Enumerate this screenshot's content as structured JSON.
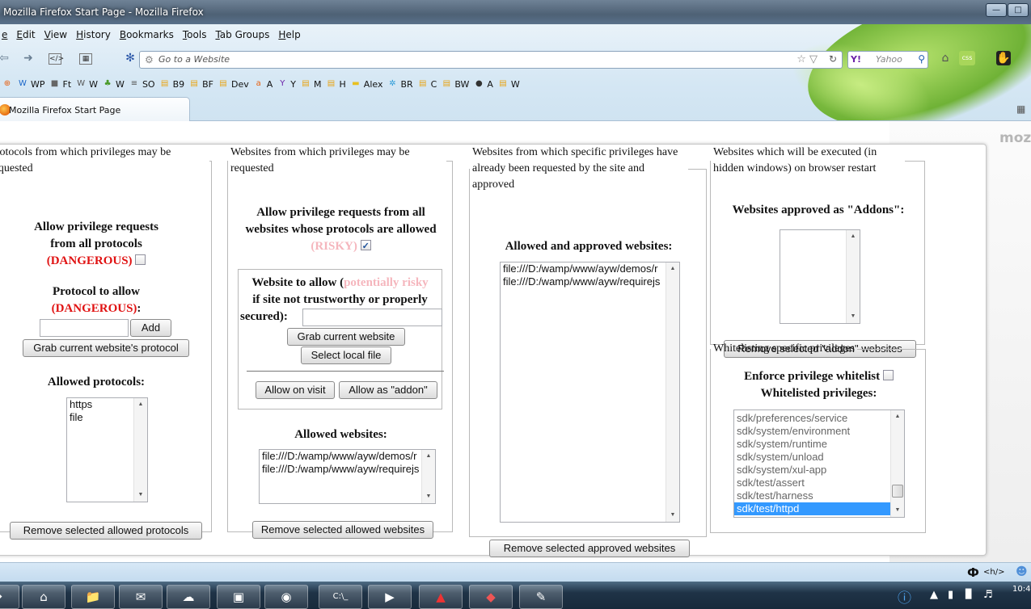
{
  "window": {
    "title": "Mozilla Firefox Start Page - Mozilla Firefox",
    "minimize": "—",
    "maximize": "□"
  },
  "menubar": [
    "e",
    "Edit",
    "View",
    "History",
    "Bookmarks",
    "Tools",
    "Tab Groups",
    "Help"
  ],
  "nav": {
    "url_placeholder": "Go to a Website",
    "search_placeholder": "Yahoo",
    "search_engine": "Y!"
  },
  "bookmarks": [
    {
      "label": "WP",
      "color": "#1b66c9",
      "icon": "W"
    },
    {
      "label": "Ft",
      "color": "#666",
      "icon": "■"
    },
    {
      "label": "W",
      "color": "#555",
      "icon": "W"
    },
    {
      "label": "W",
      "color": "#4a9a2a",
      "icon": "♣"
    },
    {
      "label": "SO",
      "color": "#555",
      "icon": "≡"
    },
    {
      "label": "B9",
      "color": "#e8a416",
      "icon": "▤"
    },
    {
      "label": "BF",
      "color": "#e8a416",
      "icon": "▤"
    },
    {
      "label": "Dev",
      "color": "#e8a416",
      "icon": "▤"
    },
    {
      "label": "A",
      "color": "#e85f0f",
      "icon": "a"
    },
    {
      "label": "Y",
      "color": "#6b1fa8",
      "icon": "Y"
    },
    {
      "label": "M",
      "color": "#e8a416",
      "icon": "▤"
    },
    {
      "label": "H",
      "color": "#e8a416",
      "icon": "▤"
    },
    {
      "label": "Alex",
      "color": "#e8c020",
      "icon": "▬"
    },
    {
      "label": "BR",
      "color": "#2b9bd8",
      "icon": "✲"
    },
    {
      "label": "C",
      "color": "#e8a416",
      "icon": "▤"
    },
    {
      "label": "BW",
      "color": "#e8a416",
      "icon": "▤"
    },
    {
      "label": "A",
      "color": "#333",
      "icon": "●"
    },
    {
      "label": "W",
      "color": "#e8a416",
      "icon": "▤"
    }
  ],
  "tab": {
    "label": "Mozilla Firefox Start Page"
  },
  "page": {
    "brand_fragment": "moz"
  },
  "col1": {
    "legend": "Protocols from which privileges may be requested",
    "allow_all_line1": "Allow privilege requests",
    "allow_all_line2": "from all protocols",
    "dangerous": "(DANGEROUS)",
    "protocol_to_allow": "Protocol to allow",
    "dangerous_colon": "(DANGEROUS)",
    "colon": ":",
    "add_button": "Add",
    "grab_protocol_button": "Grab current website's protocol",
    "allowed_protocols_heading": "Allowed protocols:",
    "allowed_protocols": [
      "https",
      "file"
    ],
    "remove_button": "Remove selected allowed protocols"
  },
  "col2": {
    "legend": "Websites from which privileges may be requested",
    "allow_all_line1": "Allow privilege requests from all",
    "allow_all_line2": "websites whose protocols are allowed",
    "risky": "(RISKY)",
    "website_to_allow": "Website to allow (",
    "potentially_risky": "potentially risky",
    "if_not_trustworthy": "if site not trustworthy or properly",
    "secured": "secured):",
    "grab_website_button": "Grab current website",
    "select_local_button": "Select local file",
    "allow_on_visit_button": "Allow on visit",
    "allow_as_addon_button": "Allow as \"addon\"",
    "allowed_websites_heading": "Allowed websites:",
    "allowed_websites": [
      "file:///D:/wamp/www/ayw/demos/r",
      "file:///D:/wamp/www/ayw/requirejs"
    ],
    "remove_button": "Remove selected allowed websites"
  },
  "col3": {
    "legend": "Websites from which specific privileges have already been requested by the site and approved",
    "heading": "Allowed and approved websites:",
    "websites": [
      "file:///D:/wamp/www/ayw/demos/r",
      "file:///D:/wamp/www/ayw/requirejs"
    ],
    "remove_button": "Remove selected approved websites"
  },
  "col4": {
    "legend": "Websites which will be executed (in hidden windows) on browser restart",
    "heading": "Websites approved as \"Addons\":",
    "remove_button": "Remove selected \"addon\" websites"
  },
  "col5": {
    "legend": "Whitelisting specific privileges",
    "enforce": "Enforce privilege whitelist",
    "heading": "Whitelisted privileges:",
    "privileges": [
      "sdk/preferences/service",
      "sdk/system/environment",
      "sdk/system/runtime",
      "sdk/system/unload",
      "sdk/system/xul-app",
      "sdk/test/assert",
      "sdk/test/harness",
      "sdk/test/httpd"
    ],
    "selected_index": 7,
    "scroll_position": 0.88
  },
  "statusbar": {
    "addon_text": "<h/>"
  },
  "taskbar": {
    "clock": "10:4"
  }
}
